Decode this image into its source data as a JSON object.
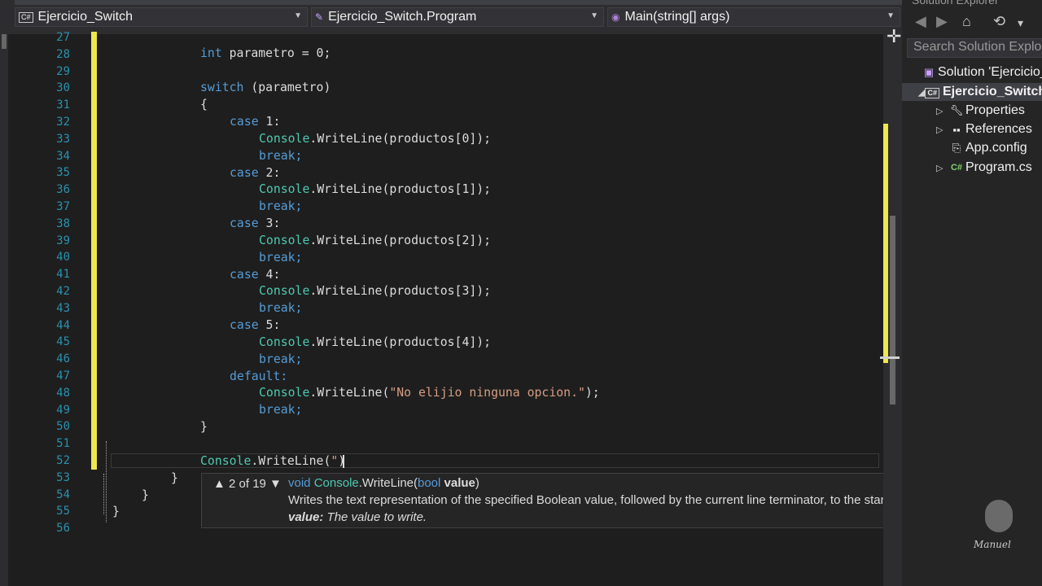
{
  "navbar": {
    "project": "Ejercicio_Switch",
    "class": "Ejercicio_Switch.Program",
    "member": "Main(string[] args)"
  },
  "editor": {
    "line_numbers": [
      "27",
      "28",
      "29",
      "30",
      "31",
      "32",
      "33",
      "34",
      "35",
      "36",
      "37",
      "38",
      "39",
      "40",
      "41",
      "42",
      "43",
      "44",
      "45",
      "46",
      "47",
      "48",
      "49",
      "50",
      "51",
      "52",
      "53",
      "54",
      "55",
      "56"
    ],
    "code": {
      "l28": {
        "kw": "int",
        "rest": " parametro = 0;"
      },
      "l30": {
        "kw": "switch",
        "rest": " (parametro)"
      },
      "l31": "{",
      "case_kw": "case",
      "break_stmt": "break;",
      "console_type": "Console",
      "writeline_call": ".WriteLine(",
      "cases": [
        {
          "label": " 1:",
          "arg": "productos[0]);"
        },
        {
          "label": " 2:",
          "arg": "productos[1]);"
        },
        {
          "label": " 3:",
          "arg": "productos[2]);"
        },
        {
          "label": " 4:",
          "arg": "productos[3]);"
        },
        {
          "label": " 5:",
          "arg": "productos[4]);"
        }
      ],
      "default_kw": "default:",
      "default_string": "\"No elijio ninguna opcion.\"",
      "default_end": ");",
      "l50": "}",
      "l52_quote": "\"",
      "l52_end": ")",
      "l53": "}",
      "l54": "}",
      "l55": "}"
    }
  },
  "tooltip": {
    "overload_nav": "▲ 2 of 19 ▼",
    "sig_void": "void",
    "sig_type": "Console",
    "sig_method": ".WriteLine(",
    "sig_param_type": "bool",
    "sig_param": " value",
    "sig_close": ")",
    "description": "Writes the text representation of the specified Boolean value, followed by the current line terminator, to the standard output stream.",
    "param_name": "value:",
    "param_desc": " The value to write."
  },
  "solution_explorer": {
    "title": "Solution Explorer",
    "search_placeholder": "Search Solution Explorer",
    "items": [
      {
        "label": "Solution 'Ejercicio_Switch'",
        "icon": "solution-icon"
      },
      {
        "label": "Ejercicio_Switch",
        "icon": "csharp-project-icon"
      },
      {
        "label": "Properties",
        "icon": "wrench-icon"
      },
      {
        "label": "References",
        "icon": "references-icon"
      },
      {
        "label": "App.config",
        "icon": "config-icon"
      },
      {
        "label": "Program.cs",
        "icon": "csharp-file-icon"
      }
    ]
  },
  "watermark": {
    "text": "Manuel"
  },
  "colors": {
    "keyword": "#569cd6",
    "type": "#4ec9b0",
    "string": "#d69d85",
    "line_number": "#2b91af",
    "change_bar": "#efe74d",
    "background": "#1e1e1e"
  }
}
